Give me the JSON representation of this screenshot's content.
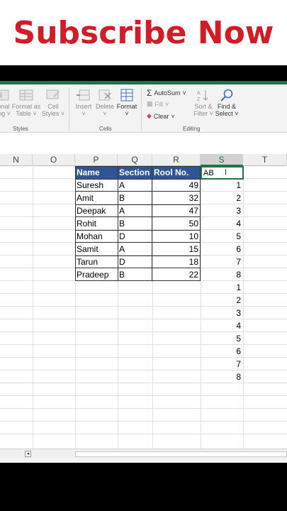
{
  "banner": {
    "title": "Subscribe Now"
  },
  "ribbon": {
    "styles": {
      "conditional_label": [
        "onal",
        "ing ˅"
      ],
      "format_as_table_label": [
        "Format as",
        "Table ˅"
      ],
      "cell_styles_label": [
        "Cell",
        "Styles ˅"
      ],
      "group_label": "Styles"
    },
    "cells": {
      "insert_label": "Insert",
      "delete_label": "Delete",
      "format_label": "Format",
      "group_label": "Cells"
    },
    "editing": {
      "autosum_label": "AutoSum",
      "fill_label": "Fill",
      "clear_label": "Clear",
      "sort_filter_label": [
        "Sort &",
        "Filter ˅"
      ],
      "find_select_label": [
        "Find &",
        "Select ˅"
      ],
      "group_label": "Editing"
    }
  },
  "columns": [
    "N",
    "O",
    "P",
    "Q",
    "R",
    "S",
    "T"
  ],
  "table": {
    "headers": [
      "Name",
      "Section",
      "Rool No."
    ],
    "rows": [
      [
        "Suresh",
        "A",
        "49"
      ],
      [
        "Amit",
        "B",
        "32"
      ],
      [
        "Deepak",
        "A",
        "47"
      ],
      [
        "Rohit",
        "B",
        "50"
      ],
      [
        "Mohan",
        "D",
        "10"
      ],
      [
        "Samit",
        "A",
        "15"
      ],
      [
        "Tarun",
        "D",
        "18"
      ],
      [
        "Pradeep",
        "B",
        "22"
      ]
    ]
  },
  "column_s": {
    "editing_value": "AB",
    "values": [
      "1",
      "2",
      "3",
      "4",
      "5",
      "6",
      "7",
      "8",
      "1",
      "2",
      "3",
      "4",
      "5",
      "6",
      "7",
      "8"
    ]
  },
  "colors": {
    "banner_red": "#d31c2a",
    "excel_green": "#217346",
    "header_blue": "#2f5597"
  }
}
